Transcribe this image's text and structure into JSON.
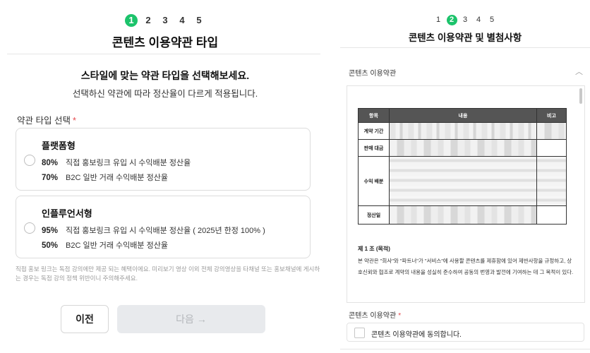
{
  "left": {
    "stepper": [
      "1",
      "2",
      "3",
      "4",
      "5"
    ],
    "active_step": 1,
    "title": "콘텐츠 이용약관 타입",
    "headline": "스타일에 맞는 약관 타입을 선택해보세요.",
    "subline": "선택하신 약관에 따라 정산율이 다르게 적용됩니다.",
    "section_label": "약관 타입 선택",
    "required_mark": "*",
    "options": [
      {
        "title": "플랫폼형",
        "rates": [
          {
            "pct": "80%",
            "desc": "직접 홍보링크 유입 시 수익배분 정산율"
          },
          {
            "pct": "70%",
            "desc": "B2C 일반 거래 수익배분 정산율"
          }
        ]
      },
      {
        "title": "인플루언서형",
        "rates": [
          {
            "pct": "95%",
            "desc": "직접 홍보링크 유입 시 수익배분 정산율 ( 2025년 한정 100% )"
          },
          {
            "pct": "50%",
            "desc": "B2C 일반 거래 수익배분 정산율"
          }
        ]
      }
    ],
    "note": "직접 홍보 링크는 독점 강의에만 제공 되는 혜택이에요. 미리보기 영상 이외 전체 강의영상을 타채널 또는 홍보채널에 게시하는 경우는 독점 강의 정책 위반이니 주의해주세요.",
    "prev_label": "이전",
    "next_label": "다음 →"
  },
  "right": {
    "stepper": [
      "1",
      "2",
      "3",
      "4",
      "5"
    ],
    "active_step": 2,
    "title": "콘텐츠 이용약관 및 별첨사항",
    "accordion_label": "콘텐츠 이용약관",
    "accordion_icon": "chevron-up-icon",
    "table": {
      "headers": [
        "항목",
        "내용",
        "비고"
      ],
      "rows": [
        "계약 기간",
        "판매 대금",
        "수익 배분",
        "정산일"
      ]
    },
    "clause_title": "제 1 조 (목적)",
    "clause_body": "본 약관은 \"회사\"와 \"파트너\"가 \"서비스\"에 사용할 콘텐츠를 제휴함에 있어 제반사항을 규정하고, 상호신뢰와 협조로 계약의 내용을 성실히 준수하여 공동의 번영과 발전에 기여하는 데 그 목적이 있다.",
    "agree_label": "콘텐츠 이용약관",
    "required_mark": "*",
    "agree_text": "콘텐츠 이용약관에 동의합니다."
  },
  "colors": {
    "accent": "#1cc36b",
    "required": "#e5484d",
    "disabled_bg": "#e8eaed"
  }
}
